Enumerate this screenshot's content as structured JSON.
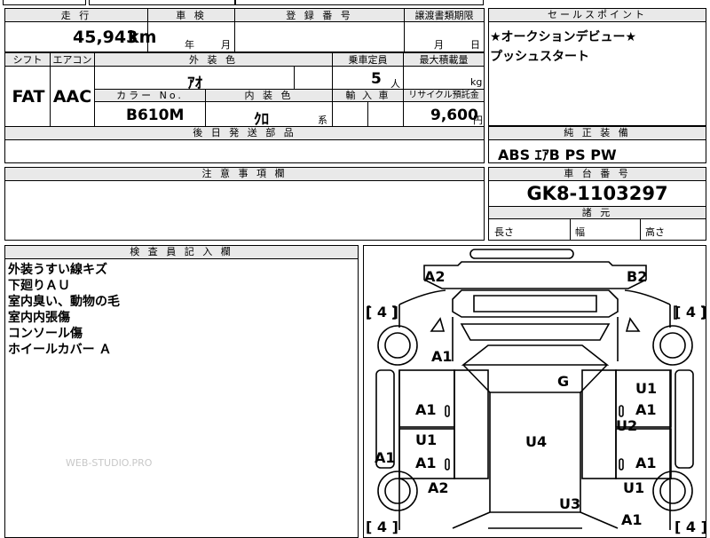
{
  "top_labels": {
    "mileage": "走 行",
    "inspection": "車 検",
    "registration": "登 録 番 号",
    "transfer_deadline": "譲渡書類期限",
    "sales_point": "セールスポイント"
  },
  "mileage": {
    "value": "45,943",
    "unit": "km"
  },
  "inspection": {
    "year_unit": "年",
    "month_unit": "月"
  },
  "transfer": {
    "month_unit": "月",
    "day_unit": "日"
  },
  "sales_points": [
    "★オークションデビュー★",
    "プッシュスタート"
  ],
  "row2_labels": {
    "shift": "シフト",
    "aircon": "エアコン",
    "exterior_color": "外 装 色",
    "capacity": "乗車定員",
    "max_load": "最大積載量",
    "color_no": "カラー No.",
    "interior_color": "内 装 色",
    "import": "輸 入 車",
    "recycle": "リサイクル預託金"
  },
  "shift": "FAT",
  "aircon": "AAC",
  "exterior_color": "ｱｵ",
  "capacity": {
    "value": "5",
    "unit": "人"
  },
  "max_load_unit": "kg",
  "color_no": "B610M",
  "interior_color": {
    "value": "ｸﾛ",
    "suffix": "系"
  },
  "recycle": {
    "value": "9,600",
    "unit": "円"
  },
  "later_parts_label": "後 日 発 送 部 品",
  "genuine_equipment": {
    "label": "純 正 装 備",
    "value": "ABS ｴｱB PS PW"
  },
  "caution_label": "注 意 事 項 欄",
  "chassis": {
    "label": "車 台 番 号",
    "value": "GK8-1103297"
  },
  "dimensions": {
    "label": "諸 元",
    "length": "長さ",
    "width": "幅",
    "height": "高さ"
  },
  "inspector": {
    "label": "検 査 員 記 入 欄",
    "notes": [
      "外装うすい線キズ",
      "下廻りＡＵ",
      "室内臭い、動物の毛",
      "室内内張傷",
      "コンソール傷",
      "ホイールカバー Ａ"
    ]
  },
  "watermark": "WEB-STUDIO.PRO",
  "diagram": {
    "tire_marks": [
      "[ 4 ]",
      "[ 4 ]",
      "[ 4 ]",
      "[ 4 ]"
    ],
    "marks": {
      "a2_front_left": "A2",
      "b2_front_right": "B2",
      "a1_left_fender": "A1",
      "a1_left_front_door_a": "A1",
      "u1_left_rear_door": "U1",
      "a1_left_rear_door": "A1",
      "a1_left_sill": "A1",
      "a2_left_rear": "A2",
      "g_windshield": "G",
      "u4_roof": "U4",
      "u3_rear": "U3",
      "u1_right_front_a": "U1",
      "a1_right_front_door": "A1",
      "u2_right_center": "U2",
      "a1_right_rear_door": "A1",
      "u1_right_rear": "U1",
      "a1_right_rear_quarter": "A1"
    }
  }
}
